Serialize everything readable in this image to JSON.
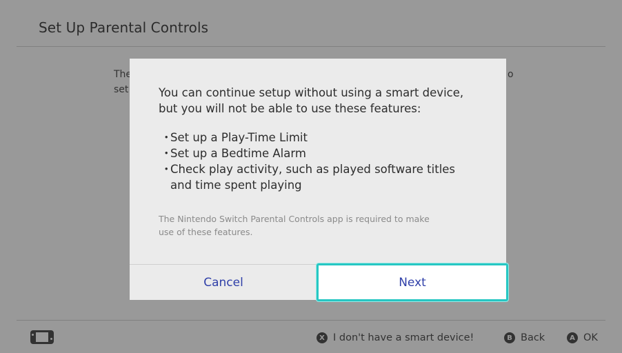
{
  "header": {
    "title": "Set Up Parental Controls"
  },
  "background": {
    "line1_fragment": "The",
    "line2_fragment": "set",
    "line1_end_fragment": "o"
  },
  "dialog": {
    "message_line1": "You can continue setup without using a smart device,",
    "message_line2": "but you will not be able to use these features:",
    "features": [
      {
        "bullet": "・",
        "text": "Set up a Play-Time Limit"
      },
      {
        "bullet": "・",
        "text": "Set up a Bedtime Alarm"
      },
      {
        "bullet": "・",
        "text": "Check play activity, such as played software titles",
        "continuation": "and time spent playing"
      }
    ],
    "note_line1": "The Nintendo Switch Parental Controls app is required to make",
    "note_line2": "use of these features.",
    "cancel_label": "Cancel",
    "next_label": "Next",
    "accent_color": "#26c7c3",
    "button_text_color": "#2f3fa8"
  },
  "footer": {
    "no_smart_icon": "X",
    "no_smart_label": "I don't have a smart device!",
    "back_icon": "B",
    "back_label": "Back",
    "ok_icon": "A",
    "ok_label": "OK"
  }
}
